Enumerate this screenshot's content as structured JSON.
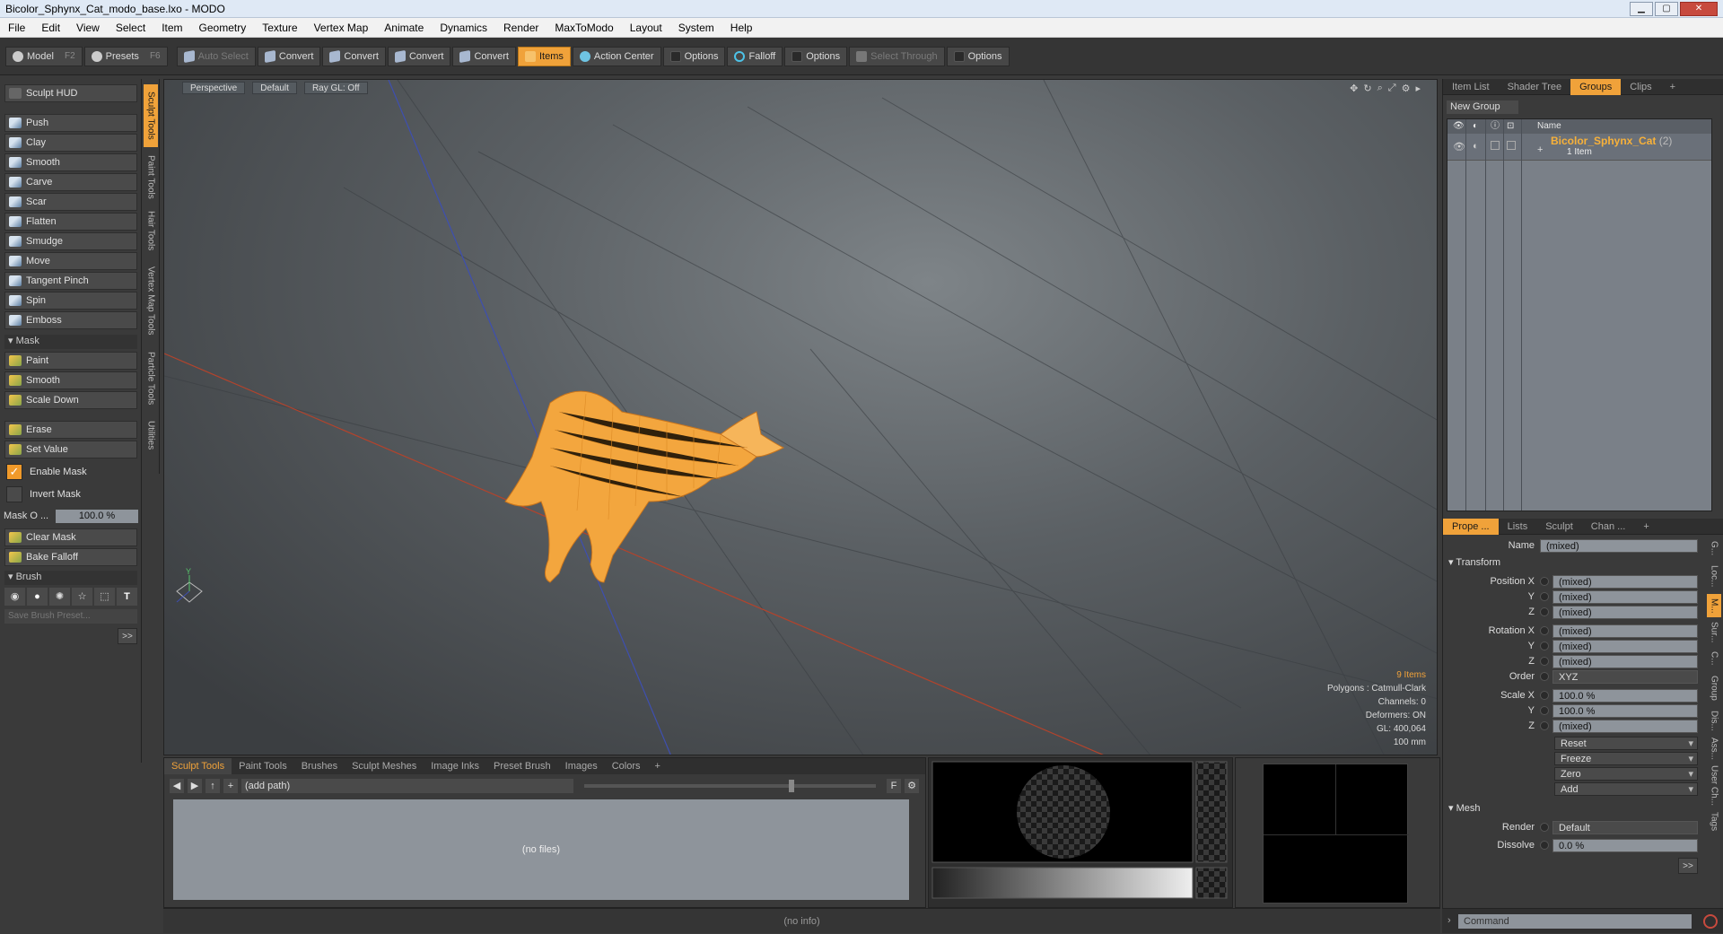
{
  "window": {
    "title": "Bicolor_Sphynx_Cat_modo_base.lxo - MODO"
  },
  "menu": [
    "File",
    "Edit",
    "View",
    "Select",
    "Item",
    "Geometry",
    "Texture",
    "Vertex Map",
    "Animate",
    "Dynamics",
    "Render",
    "MaxToModo",
    "Layout",
    "System",
    "Help"
  ],
  "toolbar": {
    "model": "Model",
    "model_key": "F2",
    "presets": "Presets",
    "presets_key": "F6",
    "auto_select": "Auto Select",
    "convert": "Convert",
    "items": "Items",
    "action_center": "Action Center",
    "options": "Options",
    "falloff": "Falloff",
    "select_through": "Select Through"
  },
  "left": {
    "hud": "Sculpt HUD",
    "tools": [
      "Push",
      "Clay",
      "Smooth",
      "Carve",
      "Scar",
      "Flatten",
      "Smudge",
      "Move",
      "Tangent Pinch",
      "Spin",
      "Emboss"
    ],
    "mask_label": "Mask",
    "mask_tools": [
      "Paint",
      "Smooth",
      "Scale Down"
    ],
    "erase": "Erase",
    "set_value": "Set Value",
    "enable_mask": "Enable Mask",
    "invert_mask": "Invert Mask",
    "mask_opacity_label": "Mask O ...",
    "mask_opacity_value": "100.0 %",
    "clear_mask": "Clear Mask",
    "bake_falloff": "Bake Falloff",
    "brush_label": "Brush",
    "save_brush": "Save Brush Preset...",
    "more": ">>"
  },
  "vtabs": [
    "Sculpt Tools",
    "Paint Tools",
    "Hair Tools",
    "Vertex Map Tools",
    "Particle Tools",
    "Utilities"
  ],
  "viewport": {
    "view": "Perspective",
    "style": "Default",
    "raygl": "Ray GL: Off",
    "info": {
      "items": "9 Items",
      "polygons": "Polygons : Catmull-Clark",
      "channels": "Channels: 0",
      "deformers": "Deformers: ON",
      "gl": "GL: 400,064",
      "scale": "100 mm"
    }
  },
  "right_top": {
    "tabs": [
      "Item List",
      "Shader Tree",
      "Groups",
      "Clips"
    ],
    "active_tab": "Groups",
    "new_group": "New Group",
    "name_col": "Name",
    "group_name": "Bicolor_Sphynx_Cat",
    "group_count": "(2)",
    "group_sub": "1 Item"
  },
  "right_bottom": {
    "tabs": [
      "Prope ...",
      "Lists",
      "Sculpt",
      "Chan ..."
    ],
    "name_label": "Name",
    "name_value": "(mixed)",
    "transform": "Transform",
    "position_x": "Position X",
    "y": "Y",
    "z": "Z",
    "rotation_x": "Rotation X",
    "order": "Order",
    "order_value": "XYZ",
    "scale_x": "Scale X",
    "mixed": "(mixed)",
    "pct": "100.0 %",
    "reset": "Reset",
    "freeze": "Freeze",
    "zero": "Zero",
    "add": "Add",
    "mesh": "Mesh",
    "render_label": "Render",
    "render_value": "Default",
    "dissolve_label": "Dissolve",
    "dissolve_value": "0.0 %",
    "more": ">>",
    "vtabs": [
      "G...",
      "Loc...",
      "M...",
      "Sur...",
      "C...",
      "Group",
      "Dis...",
      "Ass...",
      "User Ch...",
      "Tags"
    ]
  },
  "bottom": {
    "tabs": [
      "Sculpt Tools",
      "Paint Tools",
      "Brushes",
      "Sculpt Meshes",
      "Image Inks",
      "Preset Brush",
      "Images",
      "Colors",
      "+"
    ],
    "path": "(add path)",
    "files": "(no files)",
    "f_btn": "F"
  },
  "status": "(no info)",
  "command": "Command",
  "colors": {
    "accent": "#f0a23a",
    "wire": "#f7b13a"
  }
}
